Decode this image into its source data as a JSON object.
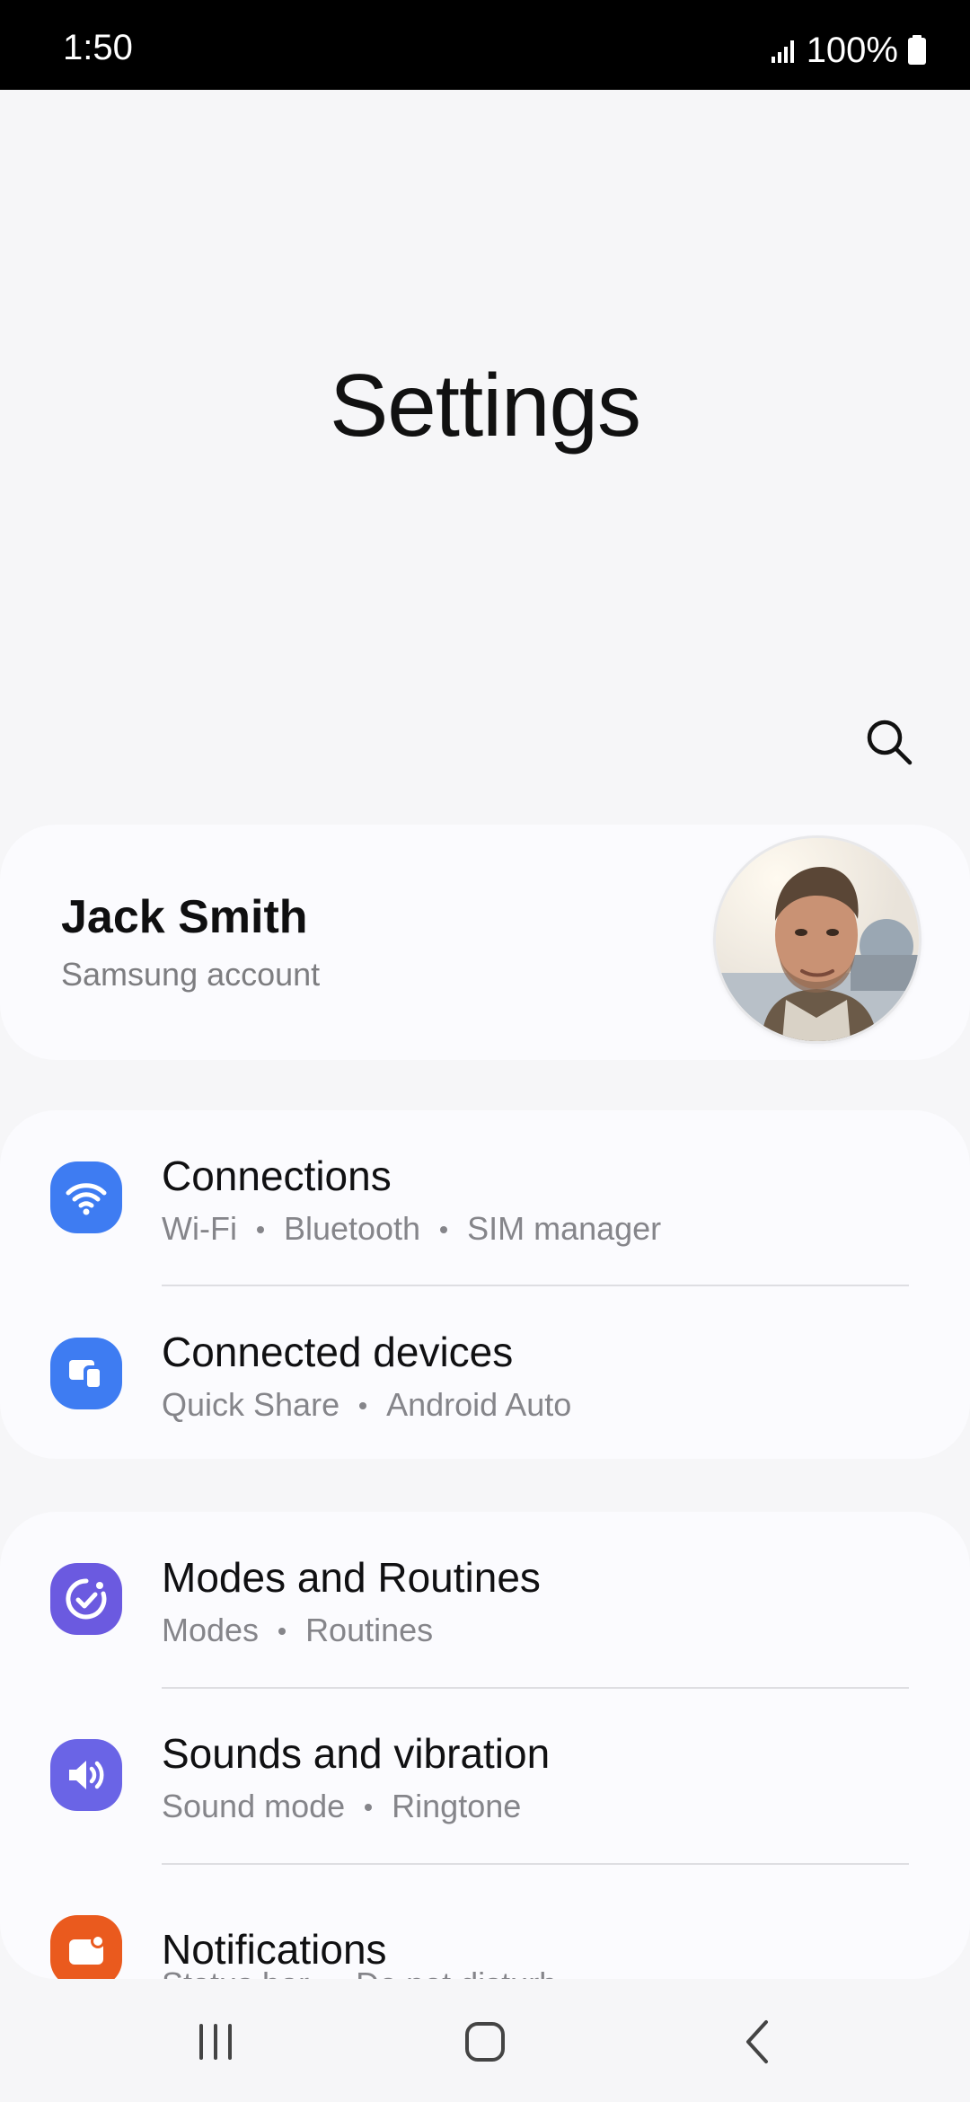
{
  "status_bar": {
    "time": "1:50",
    "battery": "100%",
    "signal_icon": "signal-icon",
    "battery_icon": "battery-icon"
  },
  "header": {
    "title": "Settings",
    "search_icon": "search-icon"
  },
  "account": {
    "name": "Jack Smith",
    "subtitle": "Samsung account",
    "avatar_icon": "profile-photo"
  },
  "groups": [
    {
      "items": [
        {
          "title": "Connections",
          "subs": [
            "Wi-Fi",
            "Bluetooth",
            "SIM manager"
          ],
          "icon": "wifi-icon",
          "icon_color": "#3e7cf2"
        },
        {
          "title": "Connected devices",
          "subs": [
            "Quick Share",
            "Android Auto"
          ],
          "icon": "connected-devices-icon",
          "icon_color": "#3e7cf2"
        }
      ]
    },
    {
      "items": [
        {
          "title": "Modes and Routines",
          "subs": [
            "Modes",
            "Routines"
          ],
          "icon": "modes-routines-icon",
          "icon_color": "#6b5ae0"
        },
        {
          "title": "Sounds and vibration",
          "subs": [
            "Sound mode",
            "Ringtone"
          ],
          "icon": "sound-icon",
          "icon_color": "#6a64e6"
        },
        {
          "title": "Notifications",
          "subs": [
            "Status bar",
            "Do not disturb"
          ],
          "icon": "notifications-icon",
          "icon_color": "#ea5a1e"
        }
      ]
    }
  ],
  "nav_bar": {
    "recents_icon": "recents-icon",
    "home_icon": "home-icon",
    "back_icon": "back-icon"
  }
}
